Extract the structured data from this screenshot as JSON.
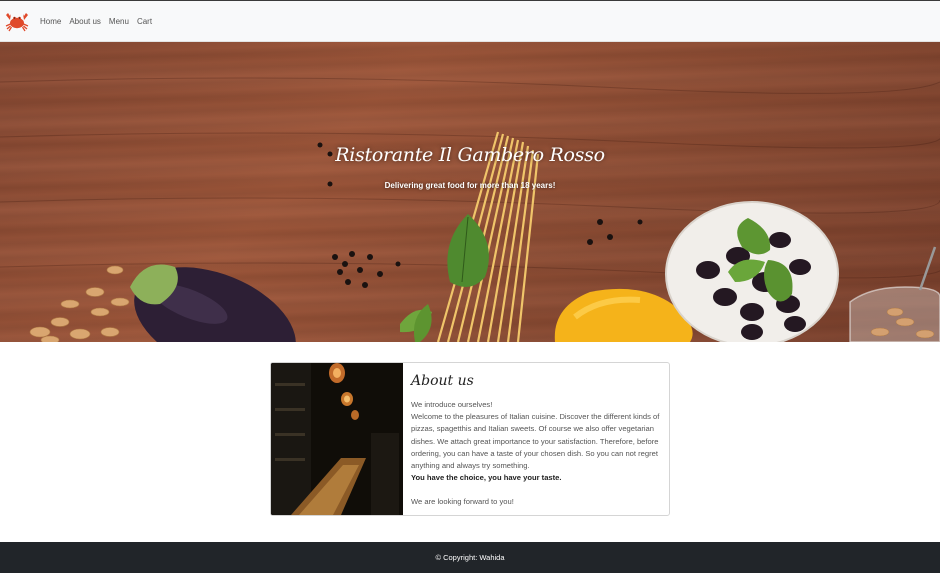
{
  "navbar": {
    "logo_icon": "crab-icon",
    "links": [
      {
        "label": "Home"
      },
      {
        "label": "About us"
      },
      {
        "label": "Menu"
      },
      {
        "label": "Cart"
      }
    ]
  },
  "hero": {
    "title": "Ristorante Il Gambero Rosso",
    "subtitle": "Delivering great food for more than 18 years!"
  },
  "about": {
    "title": "About us",
    "intro": "We introduce ourselves!",
    "paragraph": "Welcome to the pleasures of Italian cuisine. Discover the different kinds of pizzas, spagetthis and Italian sweets. Of course we also offer vegetarian dishes. We attach great importance to your satisfaction. Therefore, before ordering, you can have a taste of your chosen dish. So you can not regret anything and always try something.",
    "emphasis": "You have the choice, you have your taste.",
    "closing": "We are looking forward to you!"
  },
  "footer": {
    "copyright": "© Copyright: Wahida"
  },
  "colors": {
    "navbar_bg": "#f8f9fa",
    "footer_bg": "#212529",
    "crab": "#e0492a"
  }
}
